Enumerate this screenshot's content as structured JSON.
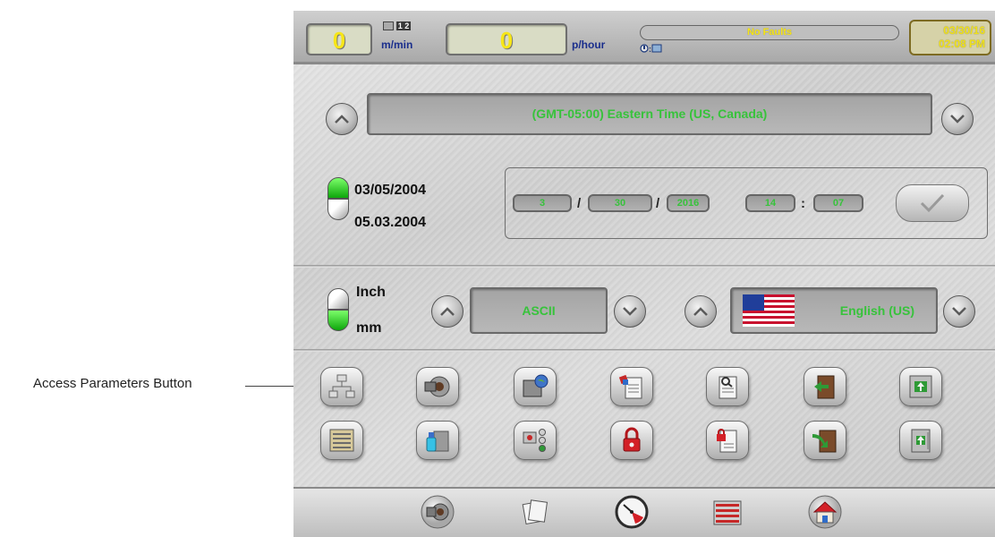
{
  "callout": {
    "label": "Access Parameters  Button"
  },
  "status": {
    "speed_value": "0",
    "speed_unit": "m/min",
    "rate_value": "0",
    "rate_unit": "p/hour",
    "fault_text": "No Faults",
    "date": "03/30/16",
    "time": "02:08 PM",
    "counter_badge": "1 2"
  },
  "timezone": {
    "value": "(GMT-05:00) Eastern Time (US, Canada)"
  },
  "date_format": {
    "option_us": "03/05/2004",
    "option_eu": "05.03.2004",
    "selected": "option_us"
  },
  "datetime_inputs": {
    "month": "3",
    "day": "30",
    "year": "2016",
    "hour": "14",
    "minute": "07",
    "sep_slash": "/",
    "sep_colon": ":"
  },
  "units": {
    "inch_label": "Inch",
    "mm_label": "mm",
    "selected": "mm"
  },
  "encoding": {
    "value": "ASCII"
  },
  "language": {
    "value": "English (US)"
  },
  "icons": {
    "row1": [
      "access-parameters-icon",
      "die-setup-icon",
      "screen-globe-icon",
      "clipboard-tools-icon",
      "wrench-document-icon",
      "door-exit-icon",
      "screen-upload-icon"
    ],
    "row2": [
      "list-panel-icon",
      "cleaning-spray-icon",
      "signal-lights-icon",
      "padlock-icon",
      "lock-document-icon",
      "door-enter-icon",
      "panel-upload-icon"
    ],
    "nav": [
      "tooling-icon",
      "pages-icon",
      "pressure-gauge-icon",
      "report-icon",
      "home-icon"
    ]
  },
  "colors": {
    "field_text": "#37c33b",
    "lcd_digit": "#f7e617",
    "unit_text": "#1a2e8c"
  }
}
